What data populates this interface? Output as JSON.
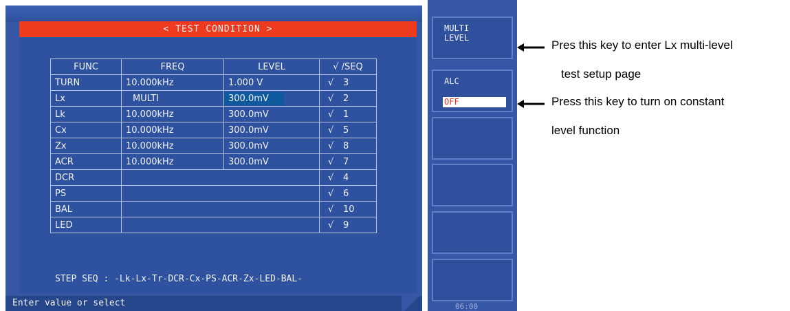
{
  "screen": {
    "title": "< TEST CONDITION >",
    "table": {
      "headers": [
        "FUNC",
        "FREQ",
        "LEVEL",
        "√ /SEQ"
      ],
      "rows": [
        {
          "func": "TURN",
          "freq": "10.000kHz",
          "level": "1.000 V",
          "check": "√",
          "seq": "3"
        },
        {
          "func": "Lx",
          "freq": "MULTI",
          "level": "300.0mV",
          "check": "√",
          "seq": "2"
        },
        {
          "func": "Lk",
          "freq": "10.000kHz",
          "level": "300.0mV",
          "check": "√",
          "seq": "1"
        },
        {
          "func": "Cx",
          "freq": "10.000kHz",
          "level": "300.0mV",
          "check": "√",
          "seq": "5"
        },
        {
          "func": "Zx",
          "freq": "10.000kHz",
          "level": "300.0mV",
          "check": "√",
          "seq": "8"
        },
        {
          "func": "ACR",
          "freq": "10.000kHz",
          "level": "300.0mV",
          "check": "√",
          "seq": "7"
        },
        {
          "func": "DCR",
          "freq": "",
          "level": "",
          "check": "√",
          "seq": "4"
        },
        {
          "func": "PS",
          "freq": "",
          "level": "",
          "check": "√",
          "seq": "6"
        },
        {
          "func": "BAL",
          "freq": "",
          "level": "",
          "check": "√",
          "seq": "10"
        },
        {
          "func": "LED",
          "freq": "",
          "level": "",
          "check": "√",
          "seq": "9"
        }
      ]
    },
    "step_seq": "STEP SEQ : -Lk-Lx-Tr-DCR-Cx-PS-ACR-Zx-LED-BAL-",
    "status": "Enter value or select"
  },
  "softkeys": {
    "multi_level": "MULTI\nLEVEL",
    "alc_label": "ALC",
    "alc_value": "OFF",
    "clock": "06:00"
  },
  "annotations": {
    "multi_note_line1": "Pres this key to enter Lx multi-level",
    "multi_note_line2": "test setup page",
    "alc_note_line1": "Press this key to turn on constant",
    "alc_note_line2": "level function"
  },
  "colors": {
    "screen_bg": "#3557a5",
    "title_bar": "#ee3a1e",
    "selected_cell": "#0f5a9e",
    "alc_value_text": "#e8321f"
  }
}
